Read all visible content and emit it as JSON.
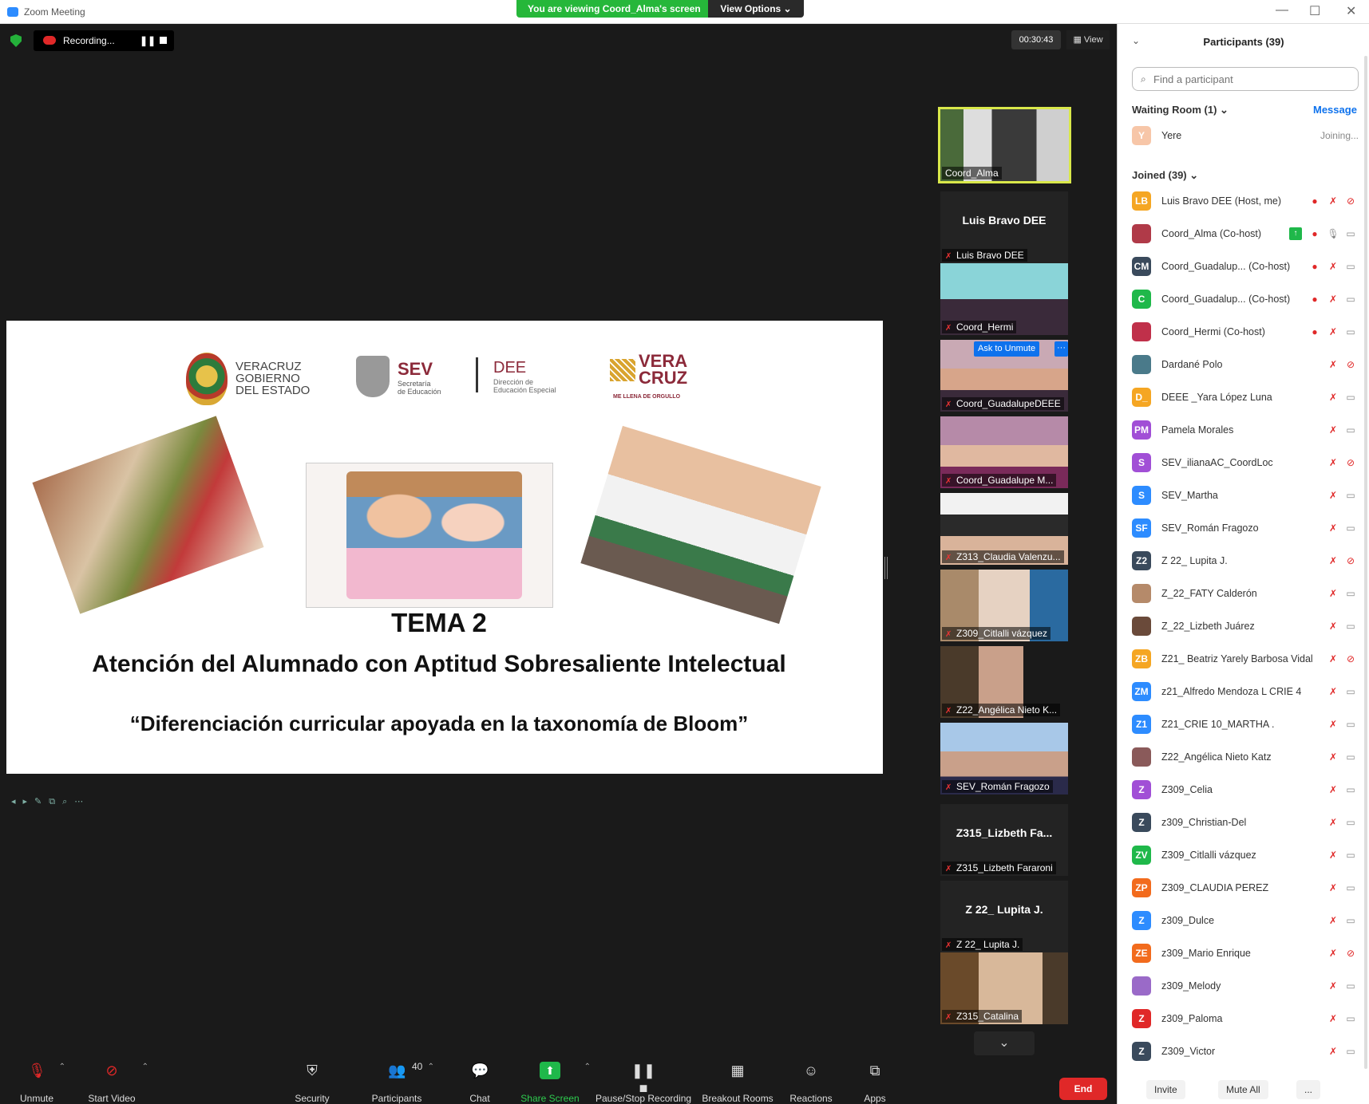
{
  "window": {
    "title": "Zoom Meeting",
    "viewing_banner": "You are viewing Coord_Alma's screen",
    "view_options": "View Options ⌄",
    "min": "—",
    "max": "☐",
    "close": "✕"
  },
  "top_bar": {
    "recording": "Recording...",
    "pause_glyph": "❚❚",
    "timer": "00:30:43",
    "view": "▦ View"
  },
  "slide": {
    "logo1_text": "VERACRUZ\nGOBIERNO\nDEL ESTADO",
    "logo2_sev": "SEV",
    "logo2_sev_sub": "Secretaría\nde Educación",
    "logo2_dee": "DEE",
    "logo2_dee_sub": "Dirección de\nEducación Especial",
    "logo3_text": "VERA\nCRUZ",
    "logo3_slogan": "ME LLENA DE ORGULLO",
    "tema": "TEMA 2",
    "title": "Atención del Alumnado con Aptitud Sobresaliente Intelectual",
    "subtitle": "“Diferenciación curricular apoyada en la taxonomía de Bloom”",
    "nav_glyphs": "◂▸✎⧉⌕⋯"
  },
  "video_tiles": [
    {
      "label": "Coord_Alma",
      "big": ""
    },
    {
      "label": "Luis Bravo DEE",
      "big": "Luis Bravo DEE"
    },
    {
      "label": "Coord_Hermi",
      "big": ""
    },
    {
      "label": "Coord_GuadalupeDEEE",
      "big": "",
      "ask_unmute": "Ask to Unmute",
      "more": "···"
    },
    {
      "label": "Coord_Guadalupe M...",
      "big": ""
    },
    {
      "label": "Z313_Claudia Valenzu...",
      "big": ""
    },
    {
      "label": "Z309_Citlalli vázquez",
      "big": ""
    },
    {
      "label": "Z22_Angélica Nieto K...",
      "big": ""
    },
    {
      "label": "SEV_Román Fragozo",
      "big": ""
    },
    {
      "label": "Z315_Lizbeth Fararoni",
      "big": "Z315_Lizbeth Fa..."
    },
    {
      "label": "Z 22_ Lupita J.",
      "big": "Z 22_ Lupita J."
    },
    {
      "label": "Z315_Catalina",
      "big": ""
    }
  ],
  "video_scroll": "⌄",
  "toolbar": {
    "unmute": "Unmute",
    "start_video": "Start Video",
    "security": "Security",
    "participants": "Participants",
    "participants_count": "40",
    "chat": "Chat",
    "share_screen": "Share Screen",
    "pause_stop": "Pause/Stop Recording",
    "breakout": "Breakout Rooms",
    "reactions": "Reactions",
    "apps": "Apps",
    "end": "End",
    "caret": "⌃"
  },
  "panel": {
    "title": "Participants (39)",
    "collapse": "⌄",
    "search_placeholder": "Find a participant",
    "search_icon": "⌕",
    "waiting_header": "Waiting Room (1)  ⌄",
    "message": "Message",
    "waiting": {
      "initials": "Y",
      "name": "Yere",
      "status": "Joining..."
    },
    "joined_header": "Joined (39)  ⌄",
    "invite": "Invite",
    "mute_all": "Mute All",
    "more": "..."
  },
  "participants": [
    {
      "initials": "LB",
      "color": "#f5a623",
      "name": "Luis Bravo DEE (Host, me)",
      "rec": true,
      "share": false,
      "mic": "off",
      "cam": "off"
    },
    {
      "initials": "",
      "color": "#b03a48",
      "name": "Coord_Alma (Co-host)",
      "rec": true,
      "share": true,
      "mic": "on",
      "cam": "on"
    },
    {
      "initials": "CM",
      "color": "#3a4a5c",
      "name": "Coord_Guadalup...  (Co-host)",
      "rec": true,
      "share": false,
      "mic": "off",
      "cam": "on"
    },
    {
      "initials": "C",
      "color": "#1fb84a",
      "name": "Coord_Guadalup...  (Co-host)",
      "rec": true,
      "share": false,
      "mic": "off",
      "cam": "on"
    },
    {
      "initials": "",
      "color": "#c0304a",
      "name": "Coord_Hermi (Co-host)",
      "rec": true,
      "share": false,
      "mic": "off",
      "cam": "on"
    },
    {
      "initials": "",
      "color": "#4a7a8a",
      "name": "Dardané Polo",
      "rec": false,
      "share": false,
      "mic": "off",
      "cam": "off"
    },
    {
      "initials": "D_",
      "color": "#f5a623",
      "name": "DEEE _Yara López Luna",
      "rec": false,
      "share": false,
      "mic": "off",
      "cam": "on"
    },
    {
      "initials": "PM",
      "color": "#a14fd6",
      "name": "Pamela Morales",
      "rec": false,
      "share": false,
      "mic": "off",
      "cam": "on"
    },
    {
      "initials": "S",
      "color": "#a14fd6",
      "name": "SEV_ilianaAC_CoordLoc",
      "rec": false,
      "share": false,
      "mic": "off",
      "cam": "off"
    },
    {
      "initials": "S",
      "color": "#2d8cff",
      "name": "SEV_Martha",
      "rec": false,
      "share": false,
      "mic": "off",
      "cam": "on"
    },
    {
      "initials": "SF",
      "color": "#2d8cff",
      "name": "SEV_Román Fragozo",
      "rec": false,
      "share": false,
      "mic": "off",
      "cam": "on"
    },
    {
      "initials": "Z2",
      "color": "#3a4a5c",
      "name": "Z 22_ Lupita J.",
      "rec": false,
      "share": false,
      "mic": "off",
      "cam": "off"
    },
    {
      "initials": "",
      "color": "#b58a6a",
      "name": "Z_22_FATY Calderón",
      "rec": false,
      "share": false,
      "mic": "off",
      "cam": "on"
    },
    {
      "initials": "",
      "color": "#6a4a3a",
      "name": "Z_22_Lizbeth Juárez",
      "rec": false,
      "share": false,
      "mic": "off",
      "cam": "on"
    },
    {
      "initials": "ZB",
      "color": "#f5a623",
      "name": "Z21_ Beatriz Yarely Barbosa Vidal",
      "rec": false,
      "share": false,
      "mic": "off",
      "cam": "off"
    },
    {
      "initials": "ZM",
      "color": "#2d8cff",
      "name": "z21_Alfredo Mendoza L CRIE 4",
      "rec": false,
      "share": false,
      "mic": "off",
      "cam": "on"
    },
    {
      "initials": "Z1",
      "color": "#2d8cff",
      "name": "Z21_CRIE 10_MARTHA .",
      "rec": false,
      "share": false,
      "mic": "off",
      "cam": "on"
    },
    {
      "initials": "",
      "color": "#8a5a5a",
      "name": "Z22_Angélica Nieto Katz",
      "rec": false,
      "share": false,
      "mic": "off",
      "cam": "on"
    },
    {
      "initials": "Z",
      "color": "#a14fd6",
      "name": "Z309_Celia",
      "rec": false,
      "share": false,
      "mic": "off",
      "cam": "on"
    },
    {
      "initials": "Z",
      "color": "#3a4a5c",
      "name": "z309_Christian-Del",
      "rec": false,
      "share": false,
      "mic": "off",
      "cam": "on"
    },
    {
      "initials": "ZV",
      "color": "#1fb84a",
      "name": "Z309_Citlalli vázquez",
      "rec": false,
      "share": false,
      "mic": "off",
      "cam": "on"
    },
    {
      "initials": "ZP",
      "color": "#f26b1d",
      "name": "Z309_CLAUDIA PEREZ",
      "rec": false,
      "share": false,
      "mic": "off",
      "cam": "on"
    },
    {
      "initials": "Z",
      "color": "#2d8cff",
      "name": "z309_Dulce",
      "rec": false,
      "share": false,
      "mic": "off",
      "cam": "on"
    },
    {
      "initials": "ZE",
      "color": "#f26b1d",
      "name": "z309_Mario Enrique",
      "rec": false,
      "share": false,
      "mic": "off",
      "cam": "off"
    },
    {
      "initials": "",
      "color": "#9a6ac8",
      "name": "z309_Melody",
      "rec": false,
      "share": false,
      "mic": "off",
      "cam": "on"
    },
    {
      "initials": "Z",
      "color": "#e02828",
      "name": "z309_Paloma",
      "rec": false,
      "share": false,
      "mic": "off",
      "cam": "on"
    },
    {
      "initials": "Z",
      "color": "#3a4a5c",
      "name": "Z309_Victor",
      "rec": false,
      "share": false,
      "mic": "off",
      "cam": "on"
    }
  ],
  "icons": {
    "rec": "●",
    "share": "↑",
    "mic_off": "✗",
    "mic_on": "🎙",
    "cam_off": "⊘",
    "cam_on": "▭"
  }
}
